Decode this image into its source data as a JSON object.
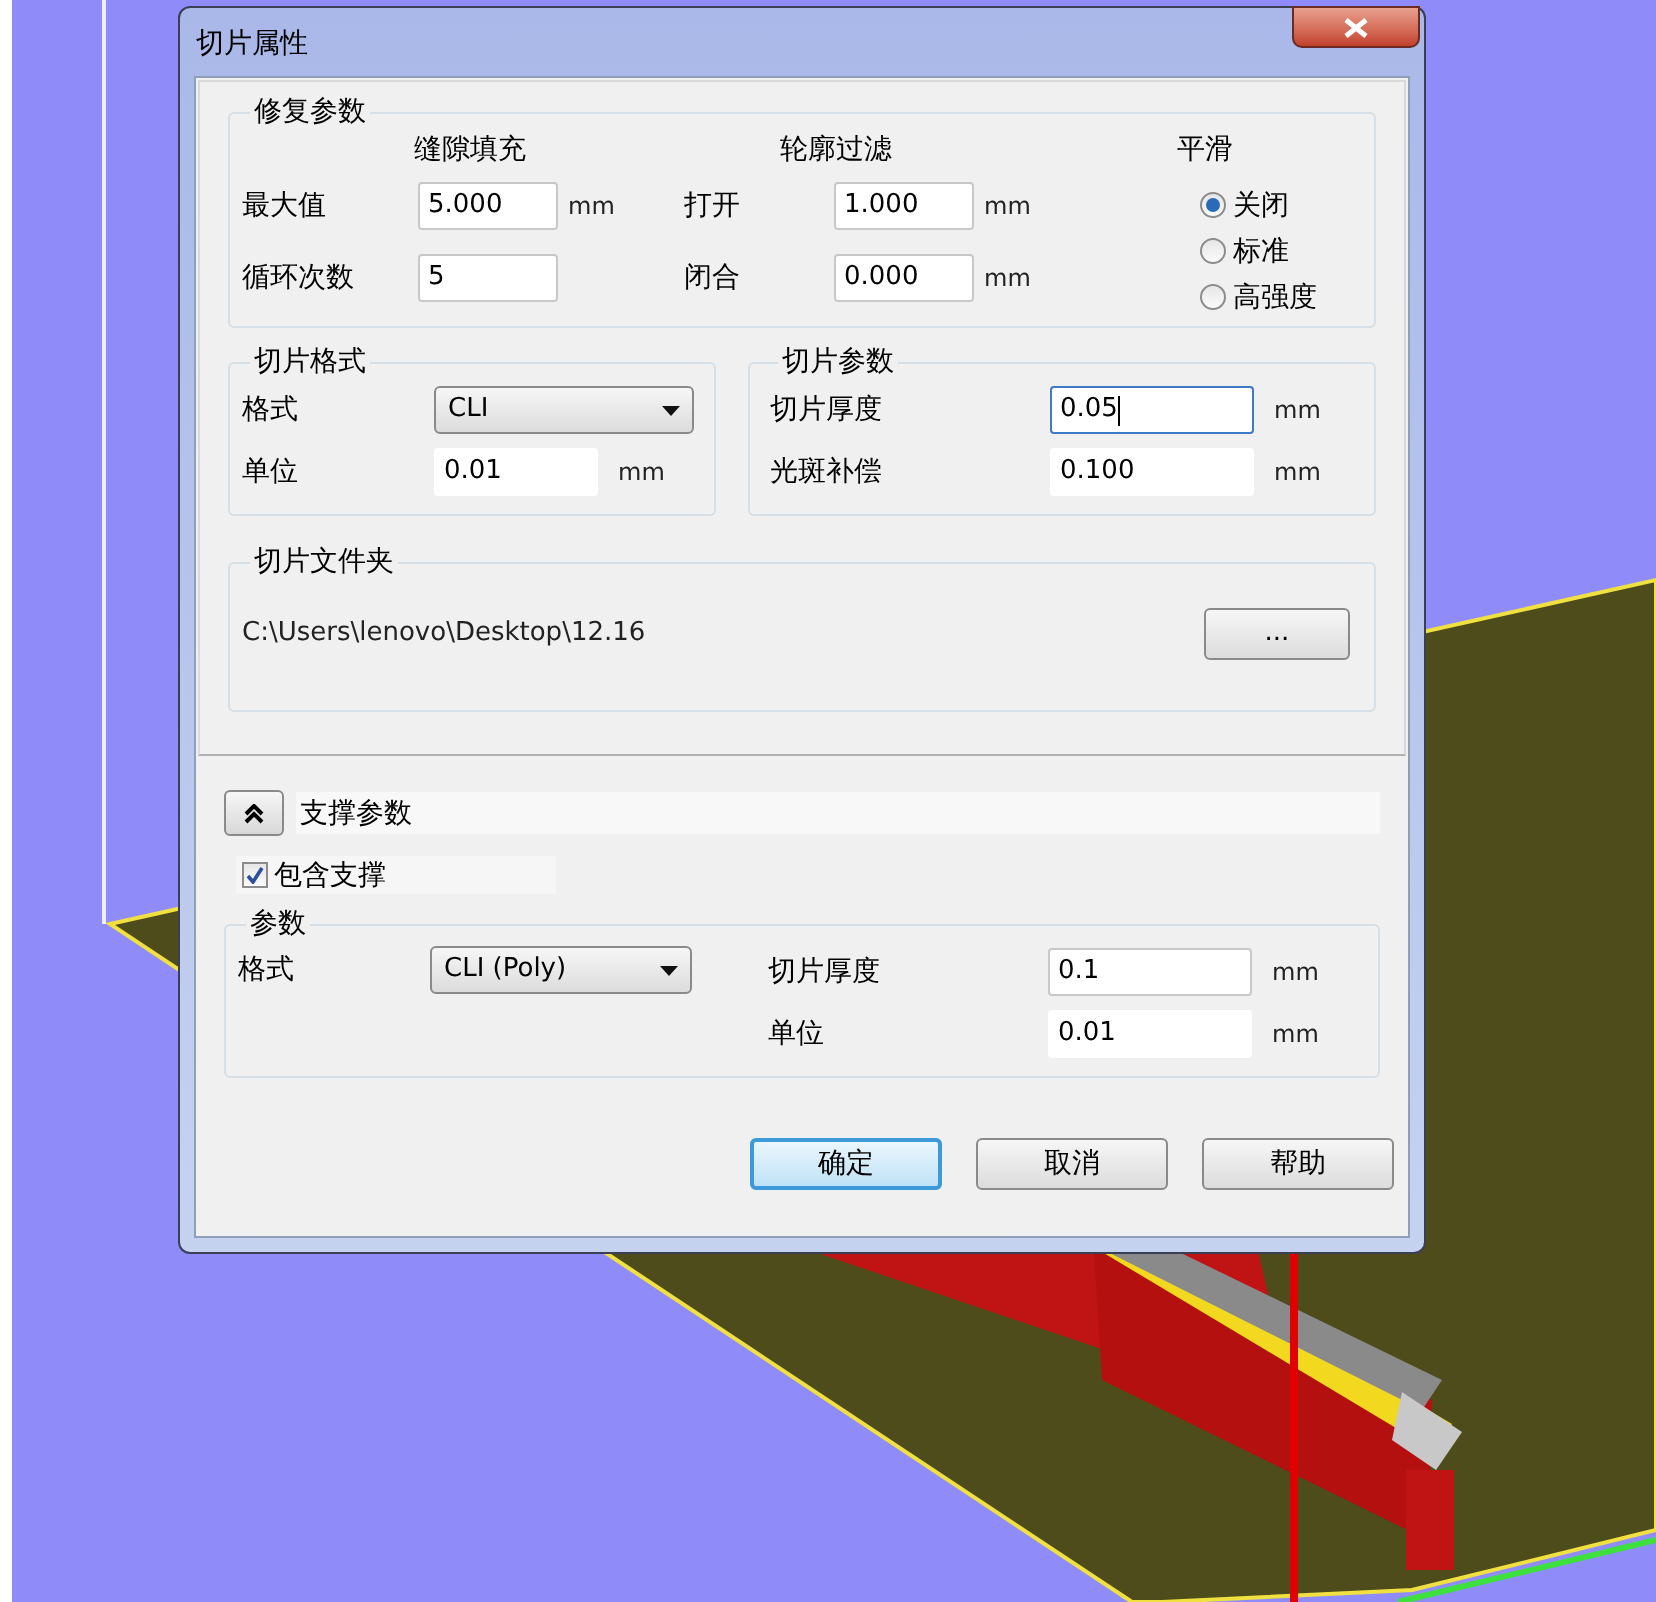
{
  "window": {
    "title": "切片属性"
  },
  "repair": {
    "title": "修复参数",
    "gap_fill": {
      "heading": "缝隙填充",
      "rows": [
        {
          "label": "最大值",
          "value": "5.000",
          "unit": "mm"
        },
        {
          "label": "循环次数",
          "value": "5"
        }
      ]
    },
    "contour_filter": {
      "heading": "轮廓过滤",
      "rows": [
        {
          "label": "打开",
          "value": "1.000",
          "unit": "mm"
        },
        {
          "label": "闭合",
          "value": "0.000",
          "unit": "mm"
        }
      ]
    },
    "smoothing": {
      "heading": "平滑",
      "options": [
        {
          "label": "关闭",
          "selected": true
        },
        {
          "label": "标准",
          "selected": false
        },
        {
          "label": "高强度",
          "selected": false
        }
      ]
    }
  },
  "slice_format": {
    "title": "切片格式",
    "format": {
      "label": "格式",
      "value": "CLI"
    },
    "unit": {
      "label": "单位",
      "value": "0.01",
      "unit": "mm"
    }
  },
  "slice_params": {
    "title": "切片参数",
    "rows": [
      {
        "label": "切片厚度",
        "value": "0.05",
        "unit": "mm",
        "kind": "focused"
      },
      {
        "label": "光斑补偿",
        "value": "0.100",
        "unit": "mm",
        "kind": "plain"
      }
    ]
  },
  "folder": {
    "title": "切片文件夹",
    "path": "C:\\Users\\lenovo\\Desktop\\12.16",
    "browse": "..."
  },
  "support": {
    "title": "支撑参数",
    "expanded": true,
    "include": {
      "label": "包含支撑",
      "checked": true
    },
    "params": {
      "title": "参数",
      "format": {
        "label": "格式",
        "value": "CLI (Poly)"
      },
      "rows": [
        {
          "label": "切片厚度",
          "value": "0.1",
          "unit": "mm",
          "kind": "boxed"
        },
        {
          "label": "单位",
          "value": "0.01",
          "unit": "mm",
          "kind": "plain"
        }
      ]
    }
  },
  "buttons": [
    {
      "label": "确定",
      "default": true
    },
    {
      "label": "取消",
      "default": false
    },
    {
      "label": "帮助",
      "default": false
    }
  ]
}
